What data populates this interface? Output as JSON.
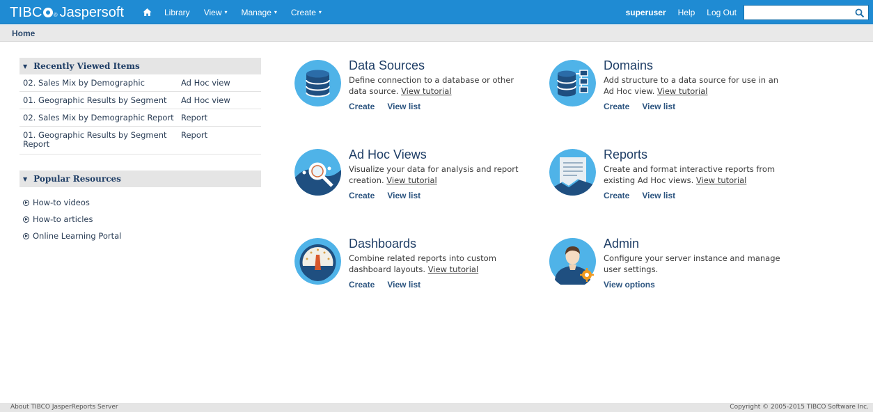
{
  "brand": {
    "tibco": "TIBC",
    "jaspersoft": "Jaspersoft",
    "reg": "®"
  },
  "nav": {
    "home_icon": "home-icon",
    "items": [
      {
        "label": "Library",
        "dropdown": false
      },
      {
        "label": "View",
        "dropdown": true
      },
      {
        "label": "Manage",
        "dropdown": true
      },
      {
        "label": "Create",
        "dropdown": true
      }
    ]
  },
  "user": {
    "name": "superuser",
    "help": "Help",
    "logout": "Log Out"
  },
  "search": {
    "value": "",
    "placeholder": "",
    "icon": "search-icon"
  },
  "breadcrumb": "Home",
  "recent": {
    "title": "Recently Viewed Items",
    "items": [
      {
        "name": "02. Sales Mix by Demographic",
        "type": "Ad Hoc view"
      },
      {
        "name": "01. Geographic Results by Segment",
        "type": "Ad Hoc view"
      },
      {
        "name": "02. Sales Mix by Demographic Report",
        "type": "Report"
      },
      {
        "name": "01. Geographic Results by Segment Report",
        "type": "Report"
      }
    ]
  },
  "popular": {
    "title": "Popular Resources",
    "links": [
      "How-to videos",
      "How-to articles",
      "Online Learning Portal"
    ]
  },
  "tiles": {
    "data_sources": {
      "title": "Data Sources",
      "desc": "Define connection to a database or other data source.",
      "tutorial": "View tutorial",
      "create": "Create",
      "list": "View list"
    },
    "domains": {
      "title": "Domains",
      "desc": "Add structure to a data source for use in an Ad Hoc view.",
      "tutorial": "View tutorial",
      "create": "Create",
      "list": "View list"
    },
    "adhoc": {
      "title": "Ad Hoc Views",
      "desc": "Visualize your data for analysis and report creation.",
      "tutorial": "View tutorial",
      "create": "Create",
      "list": "View list"
    },
    "reports": {
      "title": "Reports",
      "desc": "Create and format interactive reports from existing Ad Hoc views.",
      "tutorial": "View tutorial",
      "create": "Create",
      "list": "View list"
    },
    "dashboards": {
      "title": "Dashboards",
      "desc": "Combine related reports into custom dashboard layouts.",
      "tutorial": "View tutorial",
      "create": "Create",
      "list": "View list"
    },
    "admin": {
      "title": "Admin",
      "desc": "Configure your server instance and manage user settings.",
      "options": "View options"
    }
  },
  "footer": {
    "about": "About TIBCO JasperReports Server",
    "copyright": "Copyright © 2005-2015 TIBCO Software Inc."
  },
  "colors": {
    "topbar": "#1f8bd3",
    "icon_bg": "#4fb3e8",
    "title": "#1f3e66",
    "link": "#2d5580"
  }
}
